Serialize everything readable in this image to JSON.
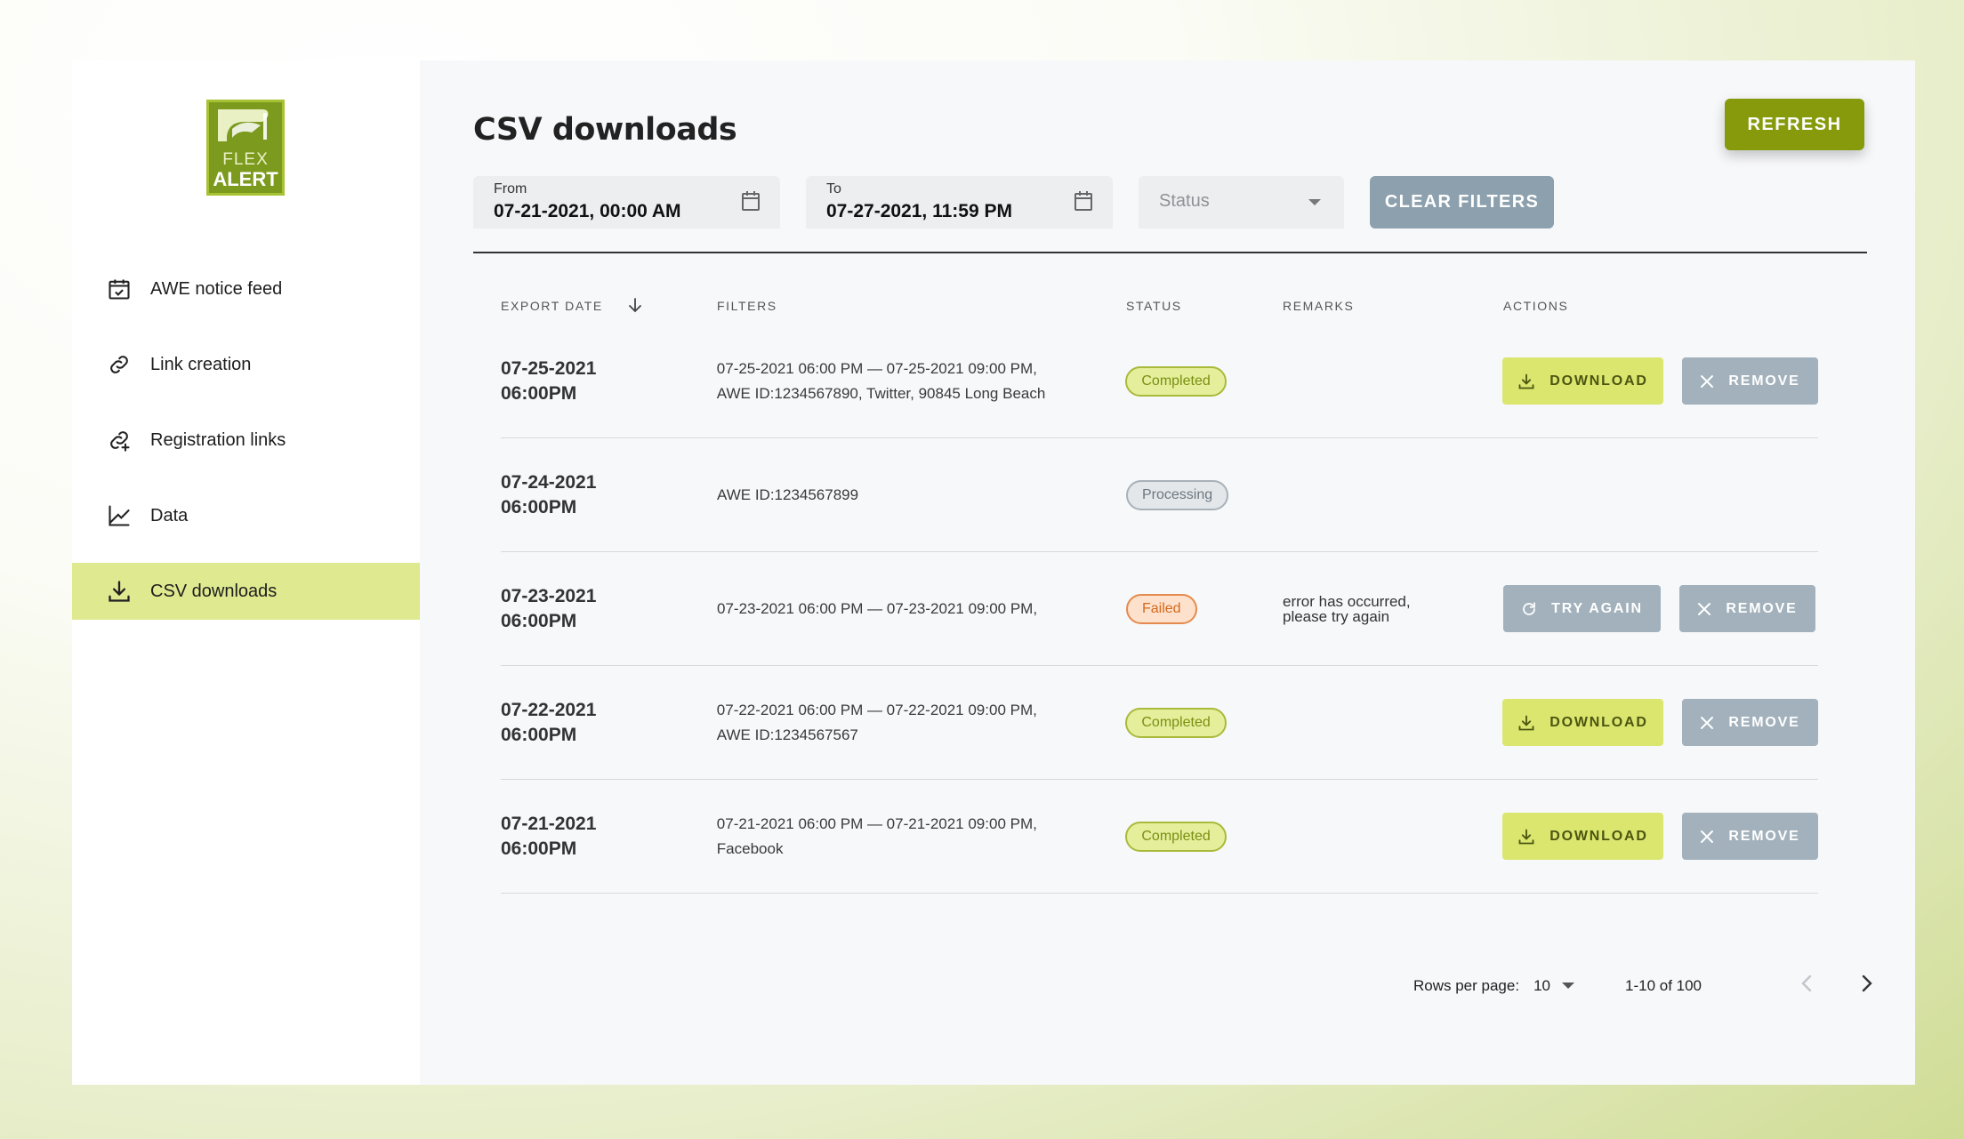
{
  "logo": {
    "line1": "FLEX",
    "line2": "ALERT",
    "brand_color": "#7c9a1e"
  },
  "sidebar": {
    "items": [
      {
        "label": "AWE notice feed",
        "icon": "calendar-check-icon"
      },
      {
        "label": "Link creation",
        "icon": "link-icon"
      },
      {
        "label": "Registration links",
        "icon": "link-add-icon"
      },
      {
        "label": "Data",
        "icon": "line-chart-icon"
      },
      {
        "label": "CSV downloads",
        "icon": "download-icon",
        "active": true
      }
    ]
  },
  "header": {
    "title": "CSV downloads",
    "refresh_label": "REFRESH"
  },
  "filters": {
    "from_label": "From",
    "from_value": "07-21-2021, 00:00 AM",
    "to_label": "To",
    "to_value": "07-27-2021, 11:59 PM",
    "status_placeholder": "Status",
    "clear_label": "CLEAR FILTERS"
  },
  "table": {
    "headers": {
      "export_date": "EXPORT DATE",
      "filters": "FILTERS",
      "status": "STATUS",
      "remarks": "REMARKS",
      "actions": "ACTIONS"
    },
    "rows": [
      {
        "date": "07-25-2021",
        "time": "06:00PM",
        "filters_line1": "07-25-2021 06:00 PM — 07-25-2021 09:00 PM,",
        "filters_line2": "AWE ID:1234567890, Twitter, 90845 Long Beach",
        "status": "Completed",
        "remarks_line1": "",
        "remarks_line2": "",
        "download": "DOWNLOAD",
        "remove": "REMOVE"
      },
      {
        "date": "07-24-2021",
        "time": "06:00PM",
        "filters_line1": "AWE ID:1234567899",
        "filters_line2": "",
        "status": "Processing",
        "remarks_line1": "",
        "remarks_line2": ""
      },
      {
        "date": "07-23-2021",
        "time": "06:00PM",
        "filters_line1": "07-23-2021 06:00 PM — 07-23-2021 09:00 PM,",
        "filters_line2": "",
        "status": "Failed",
        "remarks_line1": "error has occurred,",
        "remarks_line2": "please try again",
        "try_again": "TRY AGAIN",
        "remove": "REMOVE"
      },
      {
        "date": "07-22-2021",
        "time": "06:00PM",
        "filters_line1": "07-22-2021 06:00 PM — 07-22-2021 09:00 PM,",
        "filters_line2": "AWE ID:1234567567",
        "status": "Completed",
        "remarks_line1": "",
        "remarks_line2": "",
        "download": "DOWNLOAD",
        "remove": "REMOVE"
      },
      {
        "date": "07-21-2021",
        "time": "06:00PM",
        "filters_line1": "07-21-2021 06:00 PM — 07-21-2021 09:00 PM,",
        "filters_line2": "Facebook",
        "status": "Completed",
        "remarks_line1": "",
        "remarks_line2": "",
        "download": "DOWNLOAD",
        "remove": "REMOVE"
      }
    ]
  },
  "pagination": {
    "rows_per_page_label": "Rows per page:",
    "rows_per_page_value": "10",
    "range": "1-10 of 100"
  }
}
